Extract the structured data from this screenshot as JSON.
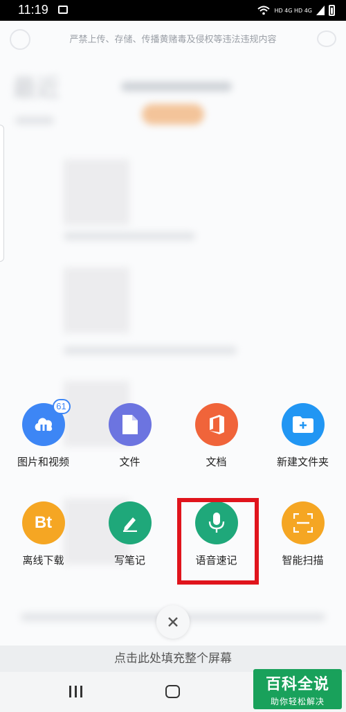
{
  "status_bar": {
    "time": "11:19",
    "right_text": "HD 4G HD 4G"
  },
  "background_app": {
    "notice": "严禁上传、存储、传播黄赌毒及侵权等违法违规内容",
    "blurred_title": "最近"
  },
  "menu": {
    "items": [
      {
        "label": "图片和视频",
        "icon": "cloud-photo-icon",
        "color": "#3d86f5",
        "badge": "61"
      },
      {
        "label": "文件",
        "icon": "file-icon",
        "color": "#6c74e0"
      },
      {
        "label": "文档",
        "icon": "office-icon",
        "color": "#f0643a"
      },
      {
        "label": "新建文件夹",
        "icon": "new-folder-icon",
        "color": "#2196f3"
      },
      {
        "label": "离线下载",
        "icon": "bt-icon",
        "icon_text": "Bt",
        "color": "#f5a623"
      },
      {
        "label": "写笔记",
        "icon": "pen-icon",
        "color": "#1fa87a"
      },
      {
        "label": "语音速记",
        "icon": "microphone-icon",
        "color": "#1fa87a"
      },
      {
        "label": "智能扫描",
        "icon": "scan-icon",
        "color": "#f5a623"
      }
    ]
  },
  "fill_screen_hint": "点击此处填充整个屏幕",
  "watermark": {
    "title": "百科全说",
    "subtitle": "助你轻松解决"
  }
}
